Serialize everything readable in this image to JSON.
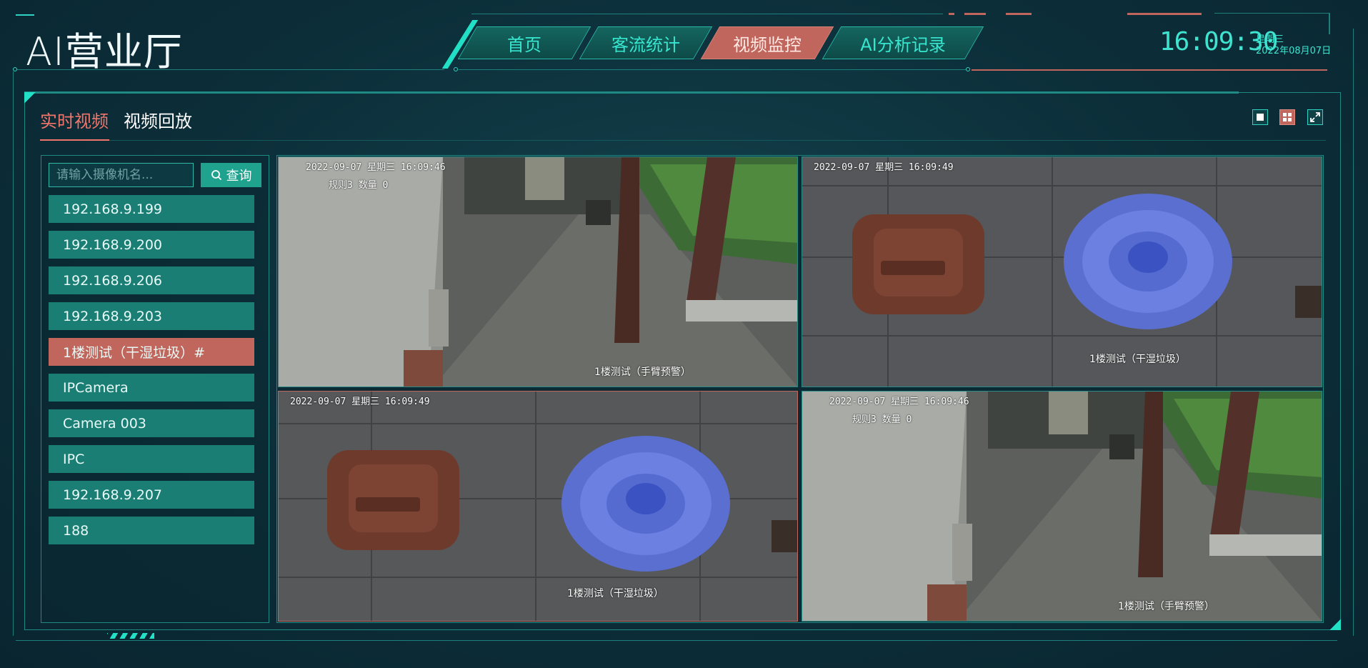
{
  "header": {
    "title": "AI营业厅",
    "nav": [
      {
        "label": "首页"
      },
      {
        "label": "客流统计"
      },
      {
        "label": "视频监控",
        "active": true
      },
      {
        "label": "AI分析记录"
      }
    ],
    "clock": {
      "time": "16:09:30",
      "weekday": "星期三",
      "date": "2022年08月07日"
    }
  },
  "tabs": [
    {
      "label": "实时视频",
      "active": true
    },
    {
      "label": "视频回放"
    }
  ],
  "layout_buttons": [
    "single-view",
    "quad-view",
    "fullscreen"
  ],
  "search": {
    "placeholder": "请输入摄像机名...",
    "button_label": "查询"
  },
  "cameras": [
    {
      "label": "192.168.9.199"
    },
    {
      "label": "192.168.9.200"
    },
    {
      "label": "192.168.9.206"
    },
    {
      "label": "192.168.9.203"
    },
    {
      "label": "1楼测试（干湿垃圾）#",
      "active": true
    },
    {
      "label": "IPCamera"
    },
    {
      "label": "Camera 003"
    },
    {
      "label": "IPC"
    },
    {
      "label": "192.168.9.207"
    },
    {
      "label": "188"
    }
  ],
  "tiles": [
    {
      "osd": "2022-09-07 星期三 16:09:46",
      "rule": "规则3 数量 0",
      "caption": "1楼测试（手臂预警）",
      "scene": "corridor"
    },
    {
      "osd": "2022-09-07 星期三 16:09:49",
      "rule": "",
      "caption": "1楼测试（干湿垃圾）",
      "scene": "bins"
    },
    {
      "osd": "2022-09-07 星期三 16:09:49",
      "rule": "",
      "caption": "1楼测试（干湿垃圾）",
      "scene": "bins"
    },
    {
      "osd": "2022-09-07 星期三 16:09:46",
      "rule": "规则3 数量 0",
      "caption": "1楼测试（手臂预警）",
      "scene": "corridor"
    }
  ],
  "colors": {
    "accent": "#37e6cf",
    "active": "#c0665c",
    "background": "#0c2e39"
  }
}
